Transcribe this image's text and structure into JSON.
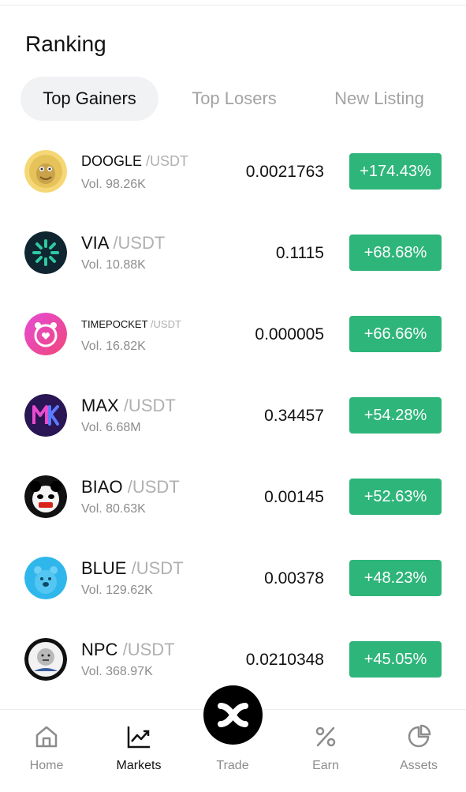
{
  "title": "Ranking",
  "tabs": [
    {
      "label": "Top Gainers"
    },
    {
      "label": "Top Losers"
    },
    {
      "label": "New Listing"
    }
  ],
  "colors": {
    "gain": "#2eb57a",
    "active_tab_bg": "#f1f2f4"
  },
  "rows": [
    {
      "base": "DOOGLE",
      "quote": "/USDT",
      "vol": "Vol. 98.26K",
      "price": "0.0021763",
      "change": "+174.43%",
      "icon": "doogle-coin-icon"
    },
    {
      "base": "VIA",
      "quote": "/USDT",
      "vol": "Vol. 10.88K",
      "price": "0.1115",
      "change": "+68.68%",
      "icon": "via-coin-icon"
    },
    {
      "base": "TIMEPOCKET",
      "quote": "/USDT",
      "vol": "Vol. 16.82K",
      "price": "0.000005",
      "change": "+66.66%",
      "icon": "timepocket-coin-icon"
    },
    {
      "base": "MAX",
      "quote": "/USDT",
      "vol": "Vol. 6.68M",
      "price": "0.34457",
      "change": "+54.28%",
      "icon": "max-coin-icon"
    },
    {
      "base": "BIAO",
      "quote": "/USDT",
      "vol": "Vol. 80.63K",
      "price": "0.00145",
      "change": "+52.63%",
      "icon": "biao-coin-icon"
    },
    {
      "base": "BLUE",
      "quote": "/USDT",
      "vol": "Vol. 129.62K",
      "price": "0.00378",
      "change": "+48.23%",
      "icon": "blue-coin-icon"
    },
    {
      "base": "NPC",
      "quote": "/USDT",
      "vol": "Vol. 368.97K",
      "price": "0.0210348",
      "change": "+45.05%",
      "icon": "npc-coin-icon"
    }
  ],
  "nav": [
    {
      "label": "Home",
      "icon": "home-icon"
    },
    {
      "label": "Markets",
      "icon": "chart-icon"
    },
    {
      "label": "Trade",
      "icon": "trade-icon"
    },
    {
      "label": "Earn",
      "icon": "percent-icon"
    },
    {
      "label": "Assets",
      "icon": "pie-chart-icon"
    }
  ]
}
